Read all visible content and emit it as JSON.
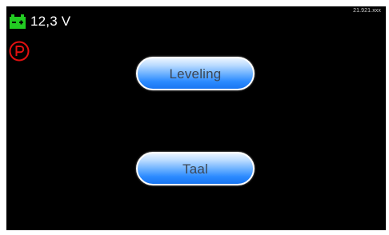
{
  "status": {
    "battery_icon": "battery-icon",
    "battery_color": "#22cc22",
    "voltage": "12,3 V",
    "parking_icon": "parking-brake-icon",
    "parking_color": "#e01010",
    "version": "21.921.xxx"
  },
  "menu": {
    "items": [
      {
        "label": "Leveling"
      },
      {
        "label": "Taal"
      }
    ]
  },
  "colors": {
    "background": "#000000",
    "button_top": "#eaf4ff",
    "button_bottom": "#1875f2",
    "button_text": "#3c4652"
  }
}
